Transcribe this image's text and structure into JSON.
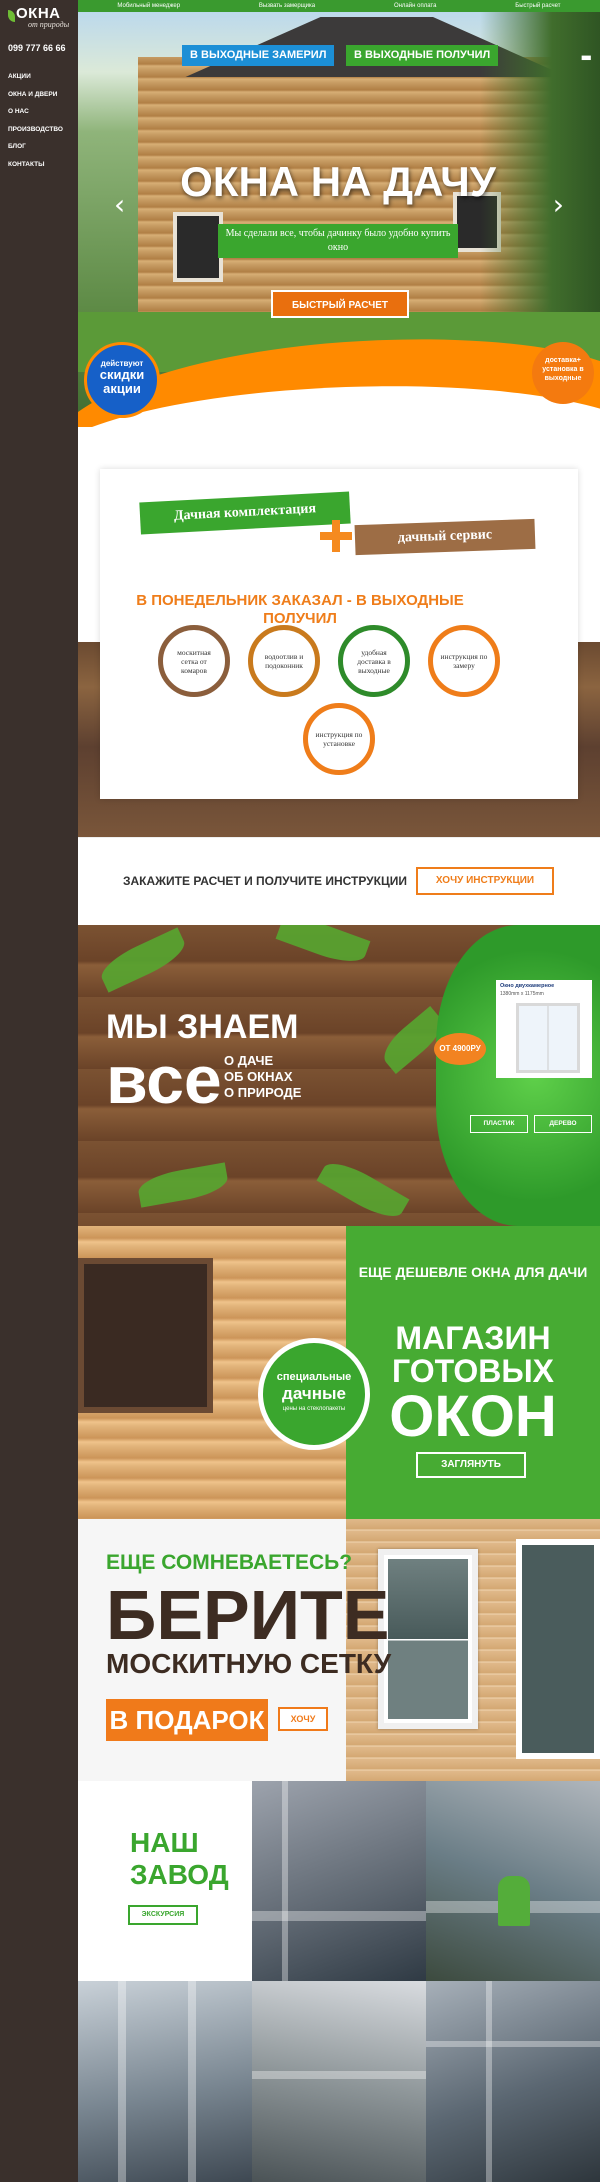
{
  "sidebar": {
    "logo_main": "ОКНА",
    "logo_sub": "от природы",
    "phone": "099 777 66 66",
    "nav": [
      "Акции",
      "Окна и двери",
      "О нас",
      "Производство",
      "Блог",
      "Контакты"
    ]
  },
  "topbar": {
    "links": [
      "Мобильный менеджер",
      "Вызвать замерщика",
      "Онлайн оплата",
      "Быстрый расчет"
    ]
  },
  "hero": {
    "tag_left": "В выходные замерил",
    "tag_right": "в выходные получил",
    "title": "ОКНА НА ДАЧУ",
    "subtitle": "Мы сделали все, чтобы дачинку было удобно купить окно",
    "button": "Быстрый расчет",
    "badge_left_top": "действуют",
    "badge_left_mid": "скидки",
    "badge_left_bot": "акции",
    "badge_right": "доставка+ установка в выходные",
    "prev_arrow": "‹",
    "next_arrow": "›",
    "accent": "#ff8a00"
  },
  "kit": {
    "label_green": "Дачная комплектация",
    "label_brown": "дачный сервис",
    "heading": "В понедельник заказал - в выходные получил",
    "features": [
      {
        "text": "москитная сетка от комаров",
        "color": "#8b5e3c"
      },
      {
        "text": "водоотлив и подоконник",
        "color": "#c97a1d"
      },
      {
        "text": "удобная доставка в выходные",
        "color": "#2e8b2a"
      },
      {
        "text": "инструкция по замеру",
        "color": "#ef7d1a"
      },
      {
        "text": "инструкция по установке",
        "color": "#ef7d1a"
      }
    ]
  },
  "order": {
    "text": "Закажите расчет и получите инструкции",
    "button": "Хочу инструкции"
  },
  "know": {
    "line1": "Мы знаем",
    "line2": "все",
    "items": [
      "о даче",
      "об окнах",
      "о природе"
    ],
    "card_title": "Окно двухкамерное",
    "card_size": "1380mm x 1175mm",
    "price": "ОТ 4900РУ",
    "btn_plastic": "Пластик",
    "btn_wood": "Дерево"
  },
  "shop": {
    "bubble_top": "специальные",
    "bubble_big": "дачные",
    "bubble_small": "цены на стеклопакеты",
    "t1": "Еще дешевле окна для дачи",
    "t2": "Магазин готовых",
    "t3": "окон",
    "button": "Заглянуть"
  },
  "doubt": {
    "l1": "Еще сомневаетесь?",
    "l2": "Берите",
    "l3": "москитную сетку",
    "l4": "в подарок",
    "button": "Хочу"
  },
  "factory": {
    "l1": "Наш",
    "l2": "завод",
    "button": "Экскурсия"
  }
}
